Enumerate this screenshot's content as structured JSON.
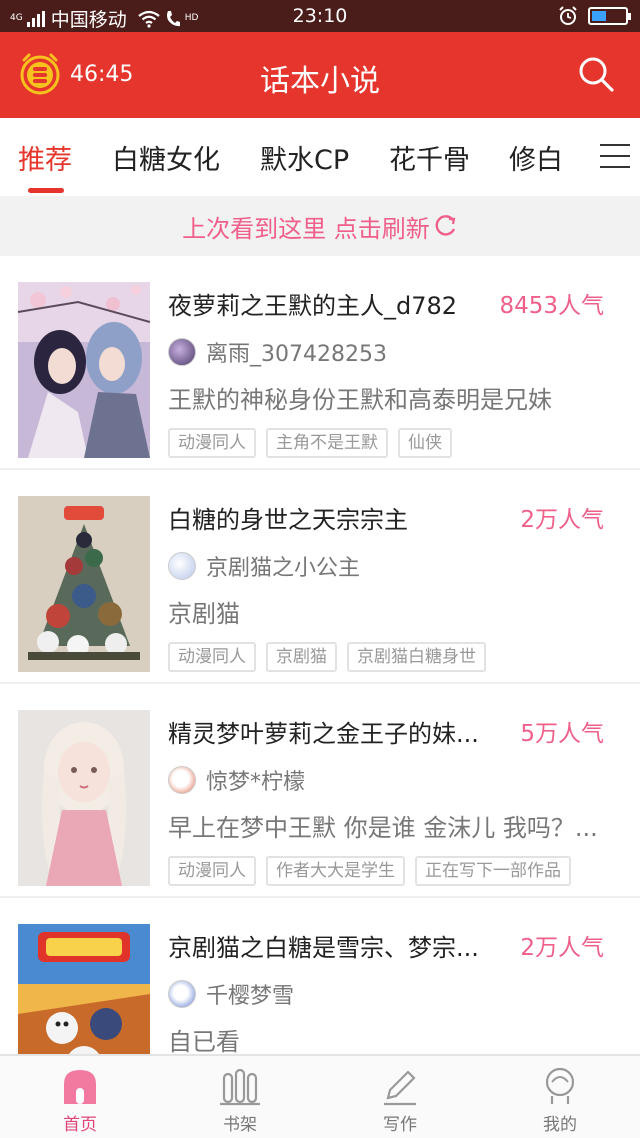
{
  "status_bar": {
    "network": "4G",
    "carrier": "中国移动",
    "hd_label": "HD",
    "time": "23:10",
    "battery_level": 0.45
  },
  "header": {
    "timer": "46:45",
    "title": "话本小说"
  },
  "tabs": [
    {
      "label": "推荐",
      "active": true
    },
    {
      "label": "白糖女化",
      "active": false
    },
    {
      "label": "默水CP",
      "active": false
    },
    {
      "label": "花千骨",
      "active": false
    },
    {
      "label": "修白",
      "active": false
    }
  ],
  "refresh": {
    "text": "上次看到这里 点击刷新"
  },
  "stories": [
    {
      "title": "夜萝莉之王默的主人_d782",
      "popularity": "8453人气",
      "author": "离雨_307428253",
      "description": "王默的神秘身份王默和高泰明是兄妹",
      "tags": [
        "动漫同人",
        "主角不是王默",
        "仙侠"
      ]
    },
    {
      "title": "白糖的身世之天宗宗主",
      "popularity": "2万人气",
      "author": "京剧猫之小公主",
      "description": "京剧猫",
      "tags": [
        "动漫同人",
        "京剧猫",
        "京剧猫白糖身世"
      ]
    },
    {
      "title": "精灵梦叶萝莉之金王子的妹...",
      "popularity": "5万人气",
      "author": "惊梦*柠檬",
      "description": "早上在梦中王默 你是谁 金沫儿 我吗？...",
      "tags": [
        "动漫同人",
        "作者大大是学生",
        "正在写下一部作品"
      ]
    },
    {
      "title": "京剧猫之白糖是雪宗、梦宗...",
      "popularity": "2万人气",
      "author": "千樱梦雪",
      "description": "自已看",
      "tags": []
    }
  ],
  "bottom_nav": [
    {
      "label": "首页",
      "icon": "home-icon",
      "active": true
    },
    {
      "label": "书架",
      "icon": "bookshelf-icon",
      "active": false
    },
    {
      "label": "写作",
      "icon": "pen-icon",
      "active": false
    },
    {
      "label": "我的",
      "icon": "profile-icon",
      "active": false
    }
  ],
  "colors": {
    "brand_red": "#e5352c",
    "accent_pink": "#ef5f8a",
    "status_bar_bg": "#4a1d1a"
  }
}
